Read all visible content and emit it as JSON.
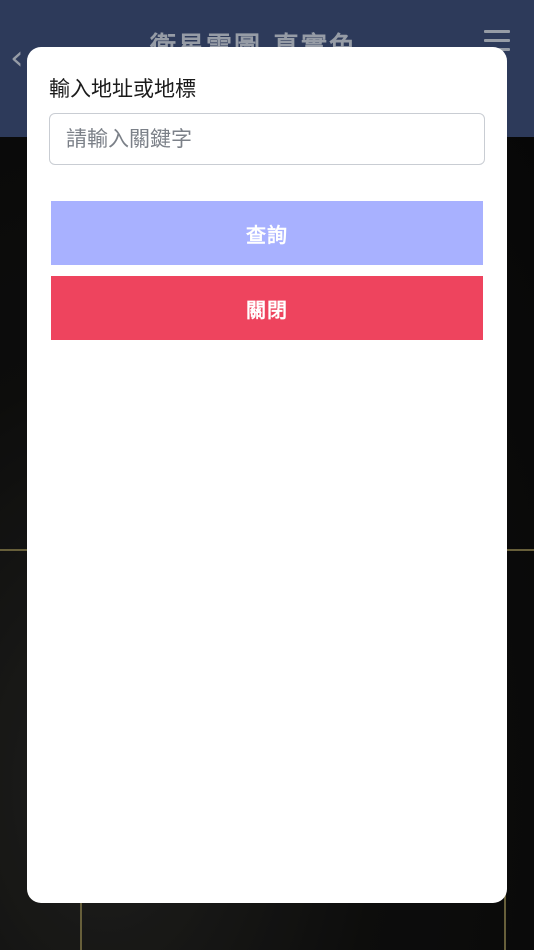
{
  "navbar": {
    "back_icon": "chevron-left-icon",
    "title": "衛星雲圖 真實色",
    "menu_icon": "hamburger-menu-icon"
  },
  "modal": {
    "label": "輸入地址或地標",
    "search_placeholder": "請輸入關鍵字",
    "search_value": "",
    "search_button_label": "查詢",
    "close_button_label": "關閉",
    "colors": {
      "search_button": "#a8b1ff",
      "close_button": "#ee445e",
      "navbar": "#3c4e79"
    }
  }
}
